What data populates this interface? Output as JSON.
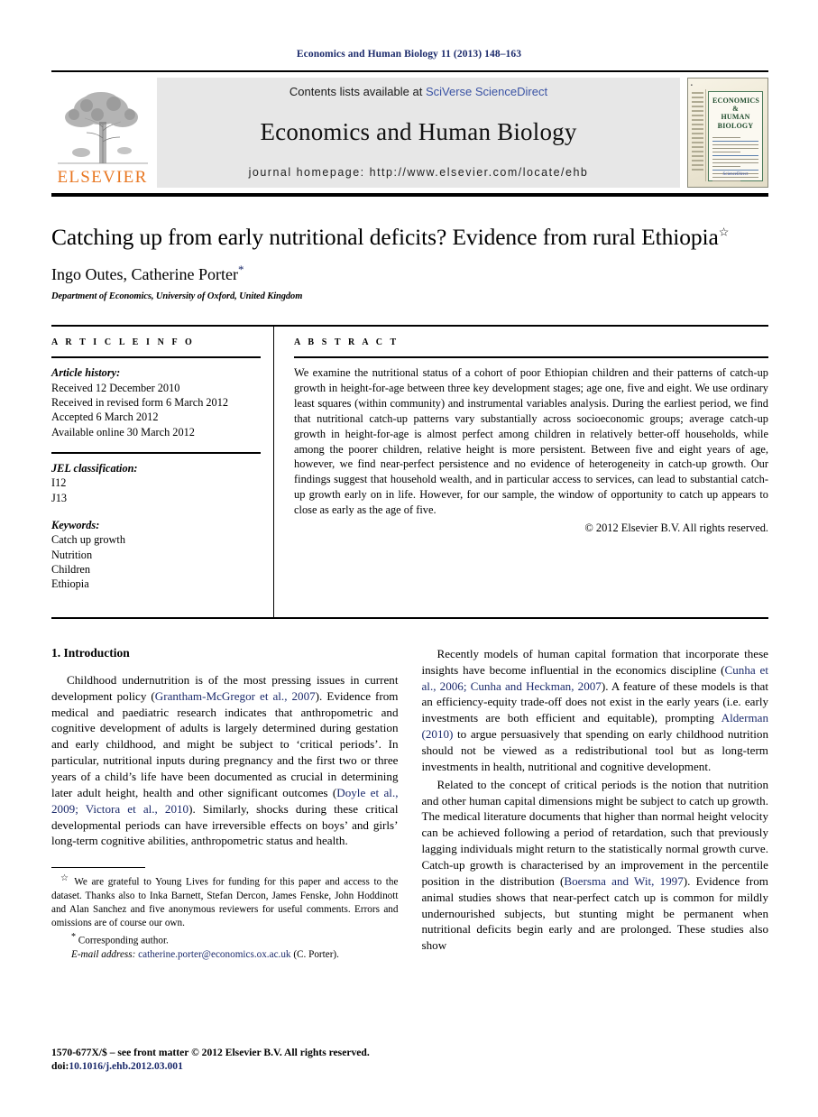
{
  "running_head": "Economics and Human Biology 11 (2013) 148–163",
  "banner": {
    "publisher_wordmark": "ELSEVIER",
    "publisher_logo_icon": "elsevier-tree-logo",
    "contents_prefix": "Contents lists available at ",
    "contents_link": "SciVerse ScienceDirect",
    "journal_name": "Economics and Human Biology",
    "homepage_label": "journal homepage: http://www.elsevier.com/locate/ehb",
    "cover": {
      "title_line1": "ECONOMICS &",
      "title_line2": "HUMAN BIOLOGY",
      "footer": "ScienceDirect"
    }
  },
  "title": {
    "text": "Catching up from early nutritional deficits? Evidence from rural Ethiopia",
    "footnote_marker": "☆"
  },
  "authors": {
    "names": "Ingo Outes, Catherine Porter",
    "corresponding_marker": "*",
    "affiliation": "Department of Economics, University of Oxford, United Kingdom"
  },
  "article_info": {
    "section_label": "A R T I C L E   I N F O",
    "history_header": "Article history:",
    "history": [
      "Received 12 December 2010",
      "Received in revised form 6 March 2012",
      "Accepted 6 March 2012",
      "Available online 30 March 2012"
    ],
    "jel_header": "JEL classification:",
    "jel_codes": [
      "I12",
      "J13"
    ],
    "keywords_header": "Keywords:",
    "keywords": [
      "Catch up growth",
      "Nutrition",
      "Children",
      "Ethiopia"
    ]
  },
  "abstract": {
    "section_label": "A B S T R A C T",
    "text": "We examine the nutritional status of a cohort of poor Ethiopian children and their patterns of catch-up growth in height-for-age between three key development stages; age one, five and eight. We use ordinary least squares (within community) and instrumental variables analysis. During the earliest period, we find that nutritional catch-up patterns vary substantially across socioeconomic groups; average catch-up growth in height-for-age is almost perfect among children in relatively better-off households, while among the poorer children, relative height is more persistent. Between five and eight years of age, however, we find near-perfect persistence and no evidence of heterogeneity in catch-up growth. Our findings suggest that household wealth, and in particular access to services, can lead to substantial catch-up growth early on in life. However, for our sample, the window of opportunity to catch up appears to close as early as the age of five.",
    "copyright": "© 2012 Elsevier B.V. All rights reserved."
  },
  "body": {
    "section_heading": "1. Introduction",
    "left_paragraphs": [
      {
        "parts": [
          {
            "t": "Childhood undernutrition is of the most pressing issues in current development policy (",
            "cite": false
          },
          {
            "t": "Grantham-McGregor et al., 2007",
            "cite": true
          },
          {
            "t": "). Evidence from medical and paediatric research indicates that anthropometric and cognitive development of adults is largely determined during gestation and early childhood, and might be subject to ‘critical periods’. In particular, nutritional inputs during pregnancy and the first two or three years of a child’s life have been documented as crucial in determining later adult height, health and other significant outcomes (",
            "cite": false
          },
          {
            "t": "Doyle et al., 2009; Victora et al., 2010",
            "cite": true
          },
          {
            "t": "). Similarly, shocks during these critical developmental periods can have irreversible effects on boys’ and girls’ long-term cognitive abilities, anthropometric status and health.",
            "cite": false
          }
        ]
      }
    ],
    "right_paragraphs": [
      {
        "parts": [
          {
            "t": "Recently models of human capital formation that incorporate these insights have become influential in the economics discipline (",
            "cite": false
          },
          {
            "t": "Cunha et al., 2006; Cunha and Heckman, 2007",
            "cite": true
          },
          {
            "t": "). A feature of these models is that an efficiency-equity trade-off does not exist in the early years (i.e. early investments are both efficient and equitable), prompting ",
            "cite": false
          },
          {
            "t": "Alderman (2010)",
            "cite": true
          },
          {
            "t": " to argue persuasively that spending on early childhood nutrition should not be viewed as a redistributional tool but as long-term investments in health, nutritional and cognitive development.",
            "cite": false
          }
        ]
      },
      {
        "parts": [
          {
            "t": "Related to the concept of critical periods is the notion that nutrition and other human capital dimensions might be subject to catch up growth. The medical literature documents that higher than normal height velocity can be achieved following a period of retardation, such that previously lagging individuals might return to the statistically normal growth curve. Catch-up growth is characterised by an improvement in the percentile position in the distribution (",
            "cite": false
          },
          {
            "t": "Boersma and Wit, 1997",
            "cite": true
          },
          {
            "t": "). Evidence from animal studies shows that near-perfect catch up is common for mildly undernourished subjects, but stunting might be permanent when nutritional deficits begin early and are prolonged. These studies also show",
            "cite": false
          }
        ]
      }
    ]
  },
  "footnotes": {
    "acknowledgement_marker": "☆",
    "acknowledgement": "We are grateful to Young Lives for funding for this paper and access to the dataset. Thanks also to Inka Barnett, Stefan Dercon, James Fenske, John Hoddinott and Alan Sanchez and five anonymous reviewers for useful comments. Errors and omissions are of course our own.",
    "corresponding_marker": "*",
    "corresponding_text": "Corresponding author.",
    "email_label": "E-mail address:",
    "email": "catherine.porter@economics.ox.ac.uk",
    "email_suffix": "(C. Porter)."
  },
  "page_footer": {
    "line1": "1570-677X/$ – see front matter © 2012 Elsevier B.V. All rights reserved.",
    "doi_prefix": "doi:",
    "doi": "10.1016/j.ehb.2012.03.001"
  },
  "colors": {
    "link": "#1b2a6b",
    "sciencedirect": "#3a53a4",
    "elsevier_orange": "#E87722",
    "banner_bg": "#e7e7e7"
  }
}
